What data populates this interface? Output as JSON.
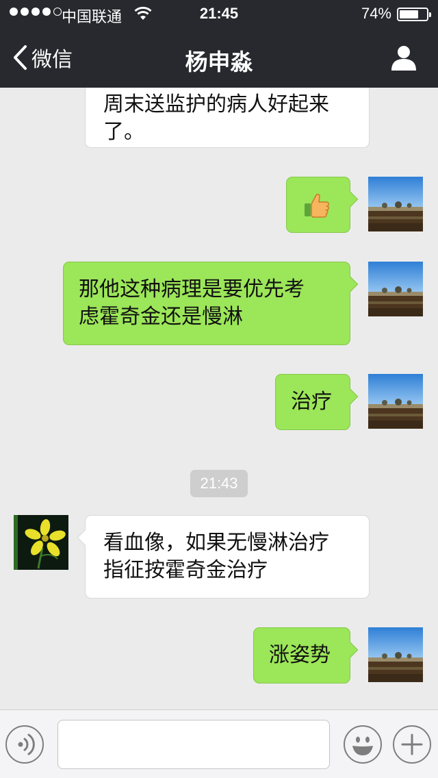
{
  "status_bar": {
    "carrier": "中国联通",
    "time": "21:45",
    "battery_percent_label": "74%",
    "battery_level": 0.74,
    "signal_bars": 4,
    "signal_total": 5
  },
  "nav": {
    "back_label": "微信",
    "title": "杨申淼"
  },
  "chat": {
    "partial_message": "周末送监护的病人好起来\n了。",
    "messages": [
      {
        "sender": "me",
        "kind": "emoji",
        "icon": "thumbs-up-icon"
      },
      {
        "sender": "me",
        "text": "那他这种病理是要优先考\n虑霍奇金还是慢淋"
      },
      {
        "sender": "me",
        "text": "治疗"
      }
    ],
    "timestamp": "21:43",
    "messages_after": [
      {
        "sender": "other",
        "text": "看血像，如果无慢淋治疗\n指征按霍奇金治疗"
      },
      {
        "sender": "me",
        "text": "涨姿势"
      }
    ]
  },
  "input_bar": {
    "message_value": "",
    "icons": [
      "voice-icon",
      "emoji-icon",
      "plus-icon"
    ]
  },
  "colors": {
    "nav_background": "#27292e",
    "chat_background": "#ebebeb",
    "my_bubble": "#9ce659",
    "other_bubble": "#ffffff",
    "timestamp_badge": "#cecece"
  }
}
